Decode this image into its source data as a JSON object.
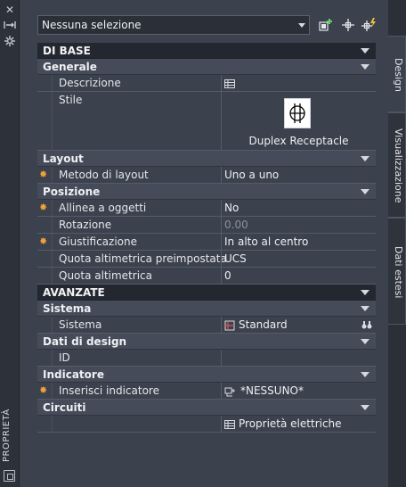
{
  "palette": {
    "panel_bg": "#3b414d",
    "section_bg": "#2a2e37",
    "accent_star": "#f2a13a"
  },
  "strip": {
    "title": "PROPRIETÀ",
    "close_icon": "close-icon",
    "pin_icon": "autohide-icon",
    "menu_icon": "settings-icon"
  },
  "selector": {
    "value": "Nessuna selezione"
  },
  "toolbar": {
    "icons": [
      "add-selection-icon",
      "select-objects-icon",
      "quick-select-icon"
    ]
  },
  "tabs": [
    {
      "label": "Design"
    },
    {
      "label": "Visualizzazione"
    },
    {
      "label": "Dati estesi"
    }
  ],
  "sections": {
    "di_base": "DI BASE",
    "generale": "Generale",
    "layout": "Layout",
    "posizione": "Posizione",
    "avanzate": "AVANZATE",
    "sistema": "Sistema",
    "dati_design": "Dati di design",
    "indicatore": "Indicatore",
    "circuiti": "Circuiti"
  },
  "fields": {
    "descrizione": {
      "label": "Descrizione"
    },
    "stile": {
      "label": "Stile",
      "value": "Duplex Receptacle"
    },
    "metodo_layout": {
      "label": "Metodo di layout",
      "value": "Uno a uno"
    },
    "allinea": {
      "label": "Allinea a oggetti",
      "value": "No"
    },
    "rotazione": {
      "label": "Rotazione",
      "value": "0.00"
    },
    "giustificazione": {
      "label": "Giustificazione",
      "value": "In alto al centro"
    },
    "quota_pre": {
      "label": "Quota altimetrica preimpostata",
      "value": "UCS"
    },
    "quota": {
      "label": "Quota altimetrica",
      "value": "0"
    },
    "sistema": {
      "label": "Sistema",
      "value": "Standard"
    },
    "id": {
      "label": "ID"
    },
    "inserisci_ind": {
      "label": "Inserisci indicatore",
      "value": "*NESSUNO*"
    },
    "circuiti": {
      "value": "Proprietà elettriche"
    }
  }
}
